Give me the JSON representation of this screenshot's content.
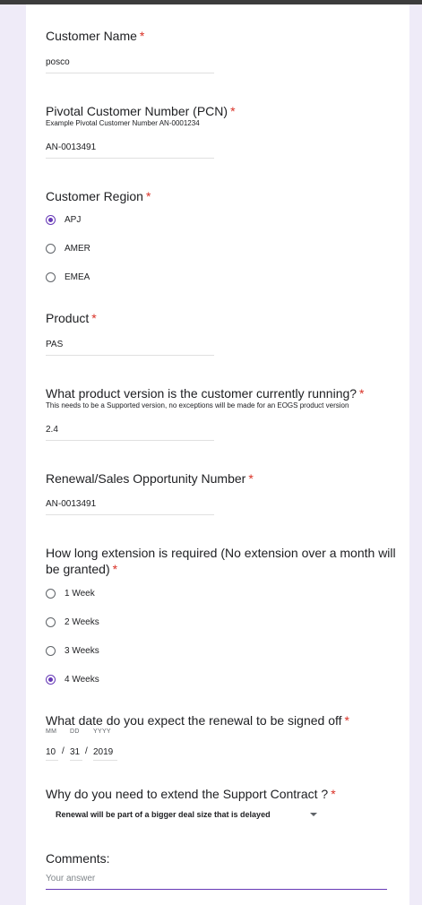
{
  "form": {
    "required_mark": "*",
    "customer_name": {
      "label": "Customer Name",
      "value": "posco"
    },
    "pcn": {
      "label": "Pivotal Customer Number (PCN)",
      "help": "Example Pivotal Customer Number AN-0001234",
      "value": "AN-0013491"
    },
    "region": {
      "label": "Customer Region",
      "options": [
        {
          "label": "APJ",
          "checked": true
        },
        {
          "label": "AMER",
          "checked": false
        },
        {
          "label": "EMEA",
          "checked": false
        }
      ]
    },
    "product": {
      "label": "Product",
      "value": "PAS"
    },
    "version": {
      "label": "What product version is the customer currently running?",
      "help": "This needs to be a Supported version, no exceptions will be made for an EOGS product version",
      "value": "2.4"
    },
    "opportunity": {
      "label": "Renewal/Sales Opportunity Number",
      "value": "AN-0013491"
    },
    "extension": {
      "label_line1": "How long extension is required (No extension over a month will",
      "label_line2": "be granted)",
      "options": [
        {
          "label": "1 Week",
          "checked": false
        },
        {
          "label": "2 Weeks",
          "checked": false
        },
        {
          "label": "3 Weeks",
          "checked": false
        },
        {
          "label": "4 Weeks",
          "checked": true
        }
      ]
    },
    "signoff_date": {
      "label": "What date do you expect the renewal to be signed off",
      "mm_label": "MM",
      "dd_label": "DD",
      "yyyy_label": "YYYY",
      "mm": "10",
      "dd": "31",
      "yyyy": "2019",
      "separator": "/"
    },
    "reason": {
      "label": "Why do you need to extend the Support Contract ?",
      "selected": "Renewal will be part of a bigger deal size that is delayed"
    },
    "comments": {
      "label": "Comments:",
      "placeholder": "Your answer"
    }
  },
  "colors": {
    "accent": "#673ab7",
    "required": "#d93025",
    "background": "#efebf8"
  }
}
